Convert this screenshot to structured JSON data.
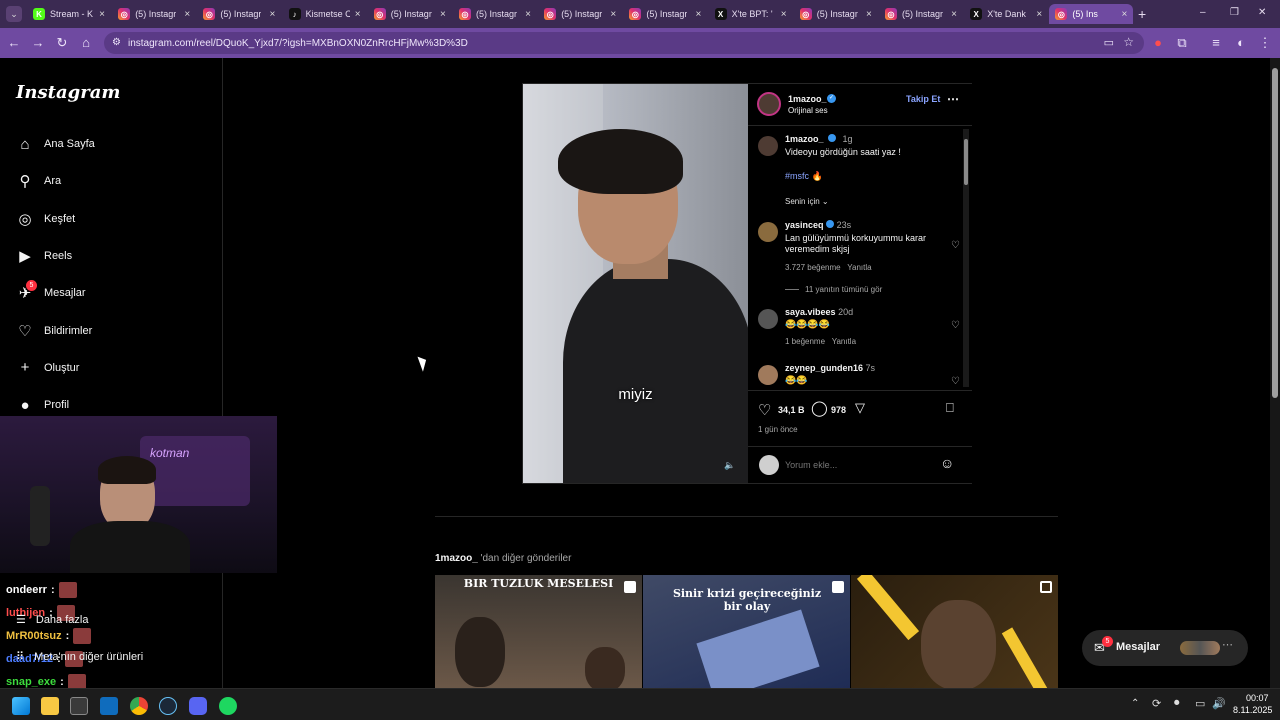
{
  "browser": {
    "tabs": [
      {
        "title": "Stream - K",
        "icon": "kick-icon"
      },
      {
        "title": "(5) Instagr",
        "icon": "instagram-icon"
      },
      {
        "title": "(5) Instagr",
        "icon": "instagram-icon"
      },
      {
        "title": "Kismetse C",
        "icon": "tiktok-icon"
      },
      {
        "title": "(5) Instagr",
        "icon": "instagram-icon"
      },
      {
        "title": "(5) Instagr",
        "icon": "instagram-icon"
      },
      {
        "title": "(5) Instagr",
        "icon": "instagram-icon"
      },
      {
        "title": "(5) Instagr",
        "icon": "instagram-icon"
      },
      {
        "title": "X'te BPT: '",
        "icon": "x-icon"
      },
      {
        "title": "(5) Instagr",
        "icon": "instagram-icon"
      },
      {
        "title": "(5) Instagr",
        "icon": "instagram-icon"
      },
      {
        "title": "X'te Dank",
        "icon": "x-icon"
      },
      {
        "title": "(5) Ins",
        "icon": "instagram-icon"
      }
    ],
    "url": "instagram.com/reel/DQuoK_Yjxd7/?igsh=MXBnOXN0ZnRrcHFjMw%3D%3D"
  },
  "sidebar": {
    "logo": "Instagram",
    "items": [
      {
        "label": "Ana Sayfa",
        "icon": "home-icon"
      },
      {
        "label": "Ara",
        "icon": "search-icon"
      },
      {
        "label": "Keşfet",
        "icon": "compass-icon"
      },
      {
        "label": "Reels",
        "icon": "reels-icon"
      },
      {
        "label": "Mesajlar",
        "icon": "messenger-icon",
        "badge": "5"
      },
      {
        "label": "Bildirimler",
        "icon": "heart-icon"
      },
      {
        "label": "Oluştur",
        "icon": "plus-icon"
      },
      {
        "label": "Profil",
        "icon": "profile-icon"
      }
    ],
    "more": "Daha fazla",
    "other_products": "Meta'nın diğer ürünleri"
  },
  "chat": [
    {
      "user": "ondeerr",
      "color": "#ffffff"
    },
    {
      "user": "luthijen",
      "color": "#ff4d4d"
    },
    {
      "user": "MrR00tsuz",
      "color": "#f0c040"
    },
    {
      "user": "daad7/12",
      "color": "#4d7dff"
    },
    {
      "user": "snap_exe",
      "color": "#3ddc3d"
    }
  ],
  "post": {
    "username": "1mazoo_",
    "audio": "Orijinal ses",
    "follow": "Takip Et",
    "caption": "Videoyu gördüğün saati yaz !",
    "caption_time": "1g",
    "hashtag": "#msfc",
    "sort": "Senin için",
    "subtitle": "miyiz",
    "comments": [
      {
        "user": "yasinceq",
        "time": "23s",
        "text": "Lan gülüyümmü korkuyummu karar veremedim skjsj",
        "likes": "3.727 beğenme",
        "reply": "Yanıtla",
        "replies": "11 yanıtın tümünü gör"
      },
      {
        "user": "saya.vibees",
        "time": "20d",
        "text": "😂😂😂😂",
        "likes": "1 beğenme",
        "reply": "Yanıtla"
      },
      {
        "user": "zeynep_gunden16",
        "time": "7s",
        "text": "😂😂"
      }
    ],
    "like_count": "34,1 B",
    "comment_count": "978",
    "posted": "1 gün önce",
    "comment_placeholder": "Yorum ekle..."
  },
  "more_posts": {
    "title_user": "1mazoo_",
    "title_suffix": " 'dan diğer gönderiler",
    "thumbs": [
      {
        "caption": "BIR TUZLUK MESELESI"
      },
      {
        "caption": "Sinir krizi geçireceğiniz bir olay"
      },
      {
        "caption": ""
      }
    ]
  },
  "messages_pill": {
    "label": "Mesajlar",
    "badge": "5"
  },
  "taskbar": {
    "time": "00:07",
    "date": "8.11.2025"
  }
}
